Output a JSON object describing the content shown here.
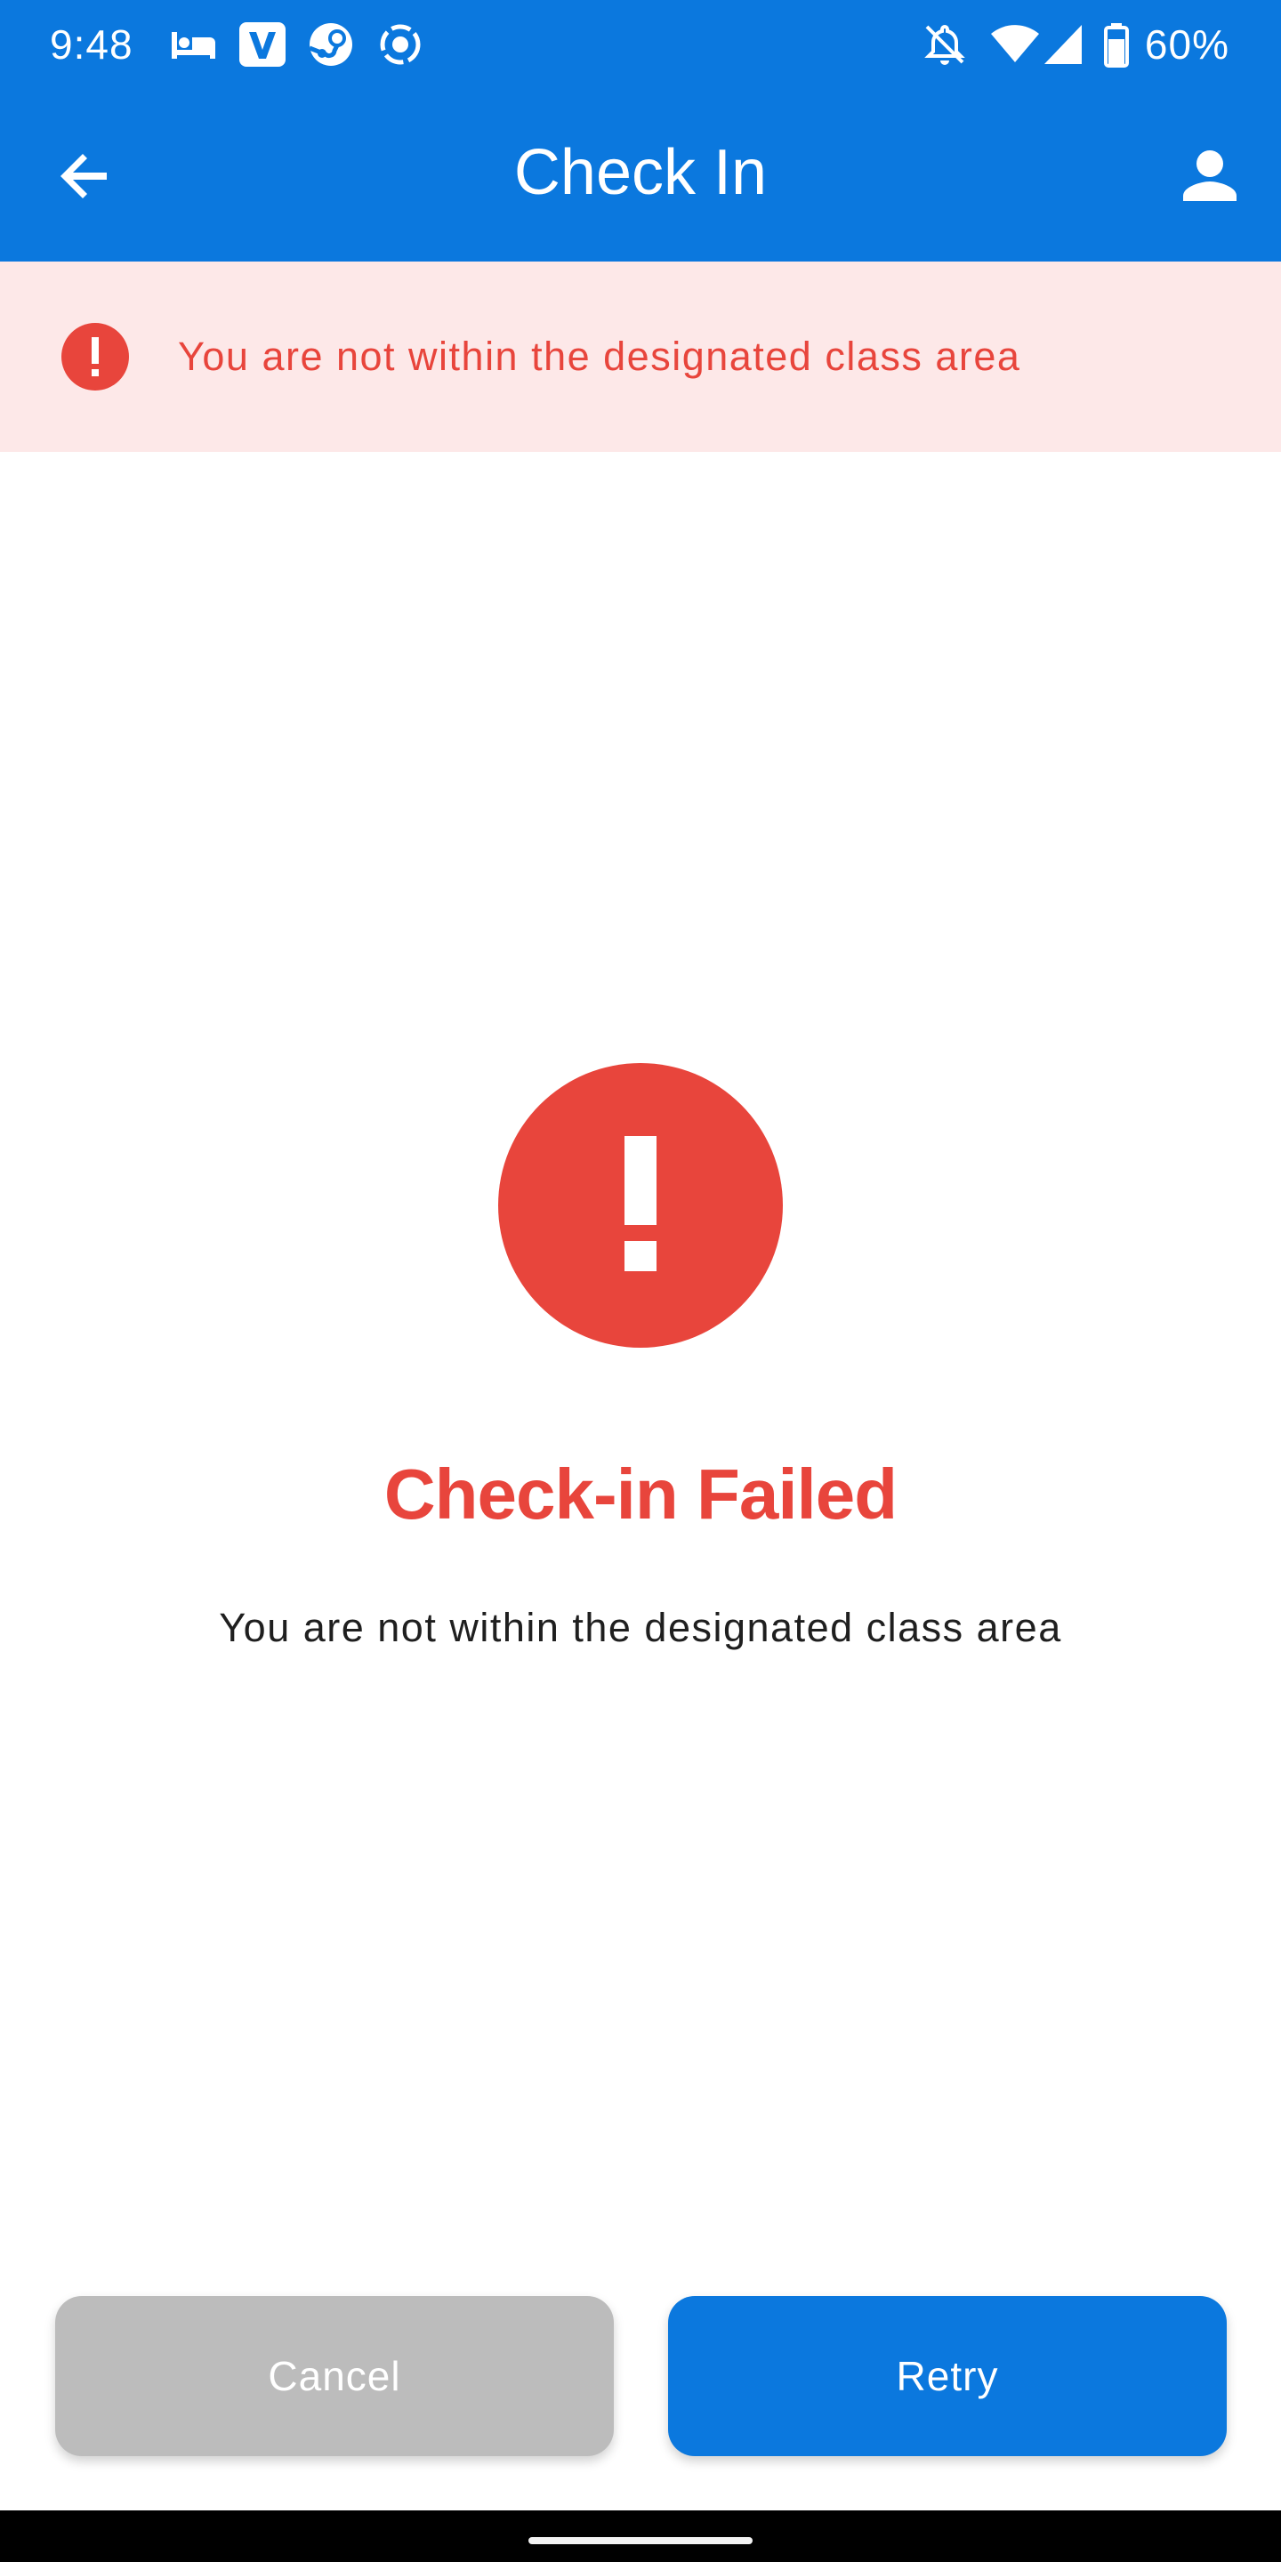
{
  "status_bar": {
    "time": "9:48",
    "battery_percent": "60%",
    "notification_icons": [
      "hotel-bed-icon",
      "venmo-v-icon",
      "steam-icon",
      "record-icon"
    ],
    "system_icons": [
      "silent-bell-icon",
      "wifi-icon",
      "cellular-signal-icon",
      "battery-icon"
    ]
  },
  "app_bar": {
    "title": "Check In",
    "back_icon": "arrow-left-icon",
    "profile_icon": "person-icon"
  },
  "banner": {
    "icon": "error-circle-icon",
    "message": "You are not within the designated class area"
  },
  "result": {
    "icon": "error-circle-icon",
    "title": "Check-in Failed",
    "message": "You are not within the designated class area"
  },
  "actions": {
    "cancel_label": "Cancel",
    "retry_label": "Retry"
  },
  "colors": {
    "primary": "#0b78de",
    "error": "#e8453c",
    "banner_background": "#fde8e8",
    "disabled_button": "#bcbcbc"
  }
}
